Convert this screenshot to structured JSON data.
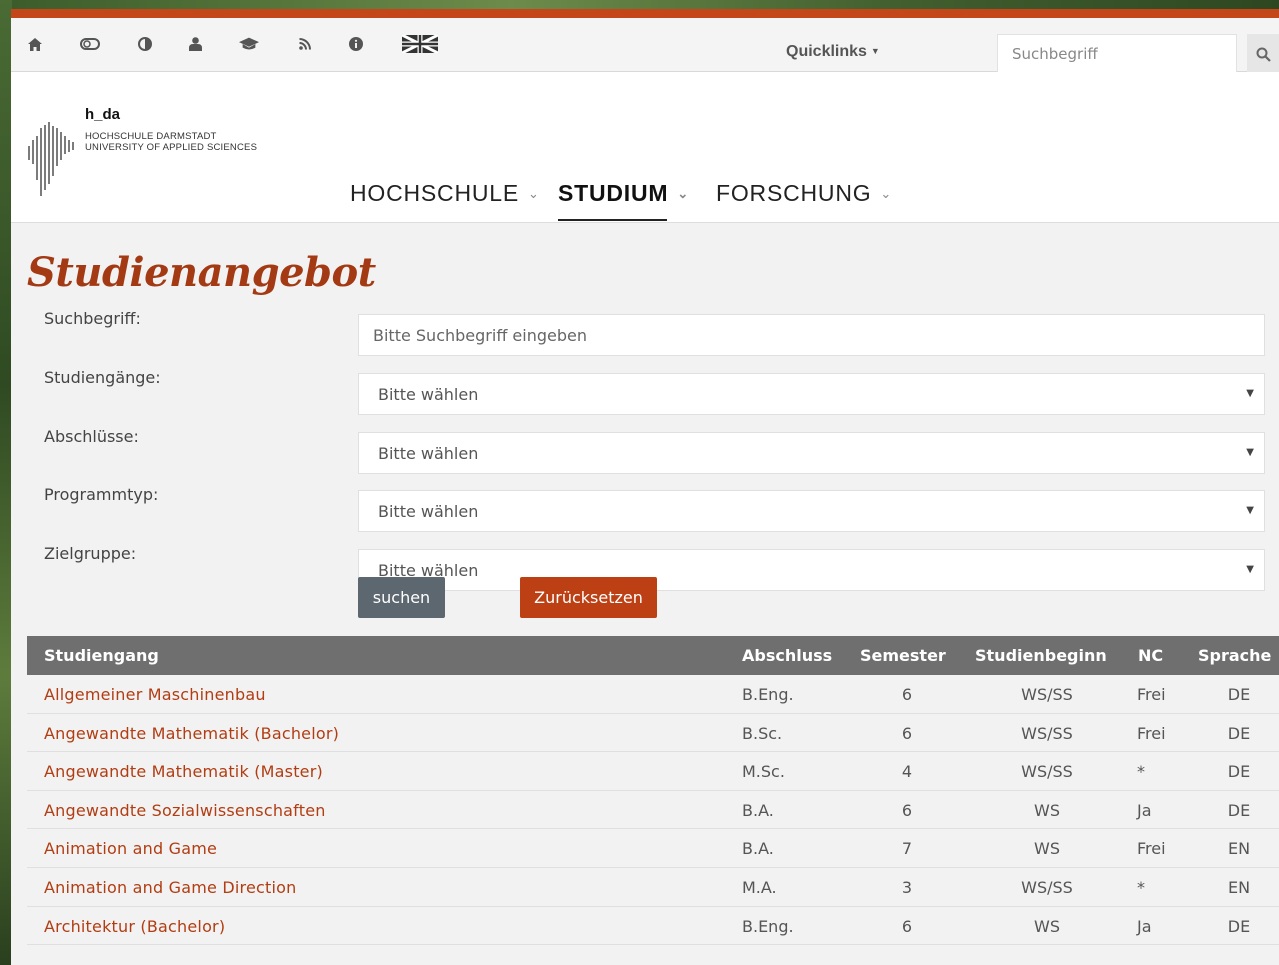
{
  "topbar": {
    "icons": [
      "home-icon",
      "toggle-icon",
      "contrast-icon",
      "user-icon",
      "graduation-cap-icon",
      "rss-icon",
      "info-icon",
      "uk-flag-icon"
    ],
    "quicklinks_label": "Quicklinks",
    "search_placeholder": "Suchbegriff"
  },
  "header": {
    "logo_name": "h_da",
    "logo_line1": "HOCHSCHULE DARMSTADT",
    "logo_line2": "UNIVERSITY OF APPLIED SCIENCES",
    "nav": [
      {
        "label": "HOCHSCHULE"
      },
      {
        "label": "STUDIUM"
      },
      {
        "label": "FORSCHUNG"
      }
    ]
  },
  "colors": {
    "accent": "#c4471a",
    "title": "#a33a14",
    "link": "#b23d12",
    "button_search": "#5c6770",
    "button_reset": "#bd3f14"
  },
  "page": {
    "title": "Studienangebot"
  },
  "form": {
    "search_label": "Suchbegriff:",
    "search_placeholder": "Bitte Suchbegriff eingeben",
    "studiengaenge_label": "Studiengänge:",
    "studiengaenge_value": "Bitte wählen",
    "abschluesse_label": "Abschlüsse:",
    "abschluesse_value": "Bitte wählen",
    "programmtyp_label": "Programmtyp:",
    "programmtyp_value": "Bitte wählen",
    "zielgruppe_label": "Zielgruppe:",
    "zielgruppe_value": "Bitte wählen",
    "search_button": "suchen",
    "reset_button": "Zurücksetzen"
  },
  "table": {
    "headers": {
      "studiengang": "Studiengang",
      "abschluss": "Abschluss",
      "semester": "Semester",
      "studienbeginn": "Studienbeginn",
      "nc": "NC",
      "sprache": "Sprache"
    },
    "rows": [
      {
        "name": "Allgemeiner Maschinenbau",
        "abschluss": "B.Eng.",
        "semester": "6",
        "beginn": "WS/SS",
        "nc": "Frei",
        "sprache": "DE"
      },
      {
        "name": "Angewandte Mathematik (Bachelor)",
        "abschluss": "B.Sc.",
        "semester": "6",
        "beginn": "WS/SS",
        "nc": "Frei",
        "sprache": "DE"
      },
      {
        "name": "Angewandte Mathematik (Master)",
        "abschluss": "M.Sc.",
        "semester": "4",
        "beginn": "WS/SS",
        "nc": "*",
        "sprache": "DE"
      },
      {
        "name": "Angewandte Sozialwissenschaften",
        "abschluss": "B.A.",
        "semester": "6",
        "beginn": "WS",
        "nc": "Ja",
        "sprache": "DE"
      },
      {
        "name": "Animation and Game",
        "abschluss": "B.A.",
        "semester": "7",
        "beginn": "WS",
        "nc": "Frei",
        "sprache": "EN"
      },
      {
        "name": "Animation and Game Direction",
        "abschluss": "M.A.",
        "semester": "3",
        "beginn": "WS/SS",
        "nc": "*",
        "sprache": "EN"
      },
      {
        "name": "Architektur (Bachelor)",
        "abschluss": "B.Eng.",
        "semester": "6",
        "beginn": "WS",
        "nc": "Ja",
        "sprache": "DE"
      }
    ]
  }
}
